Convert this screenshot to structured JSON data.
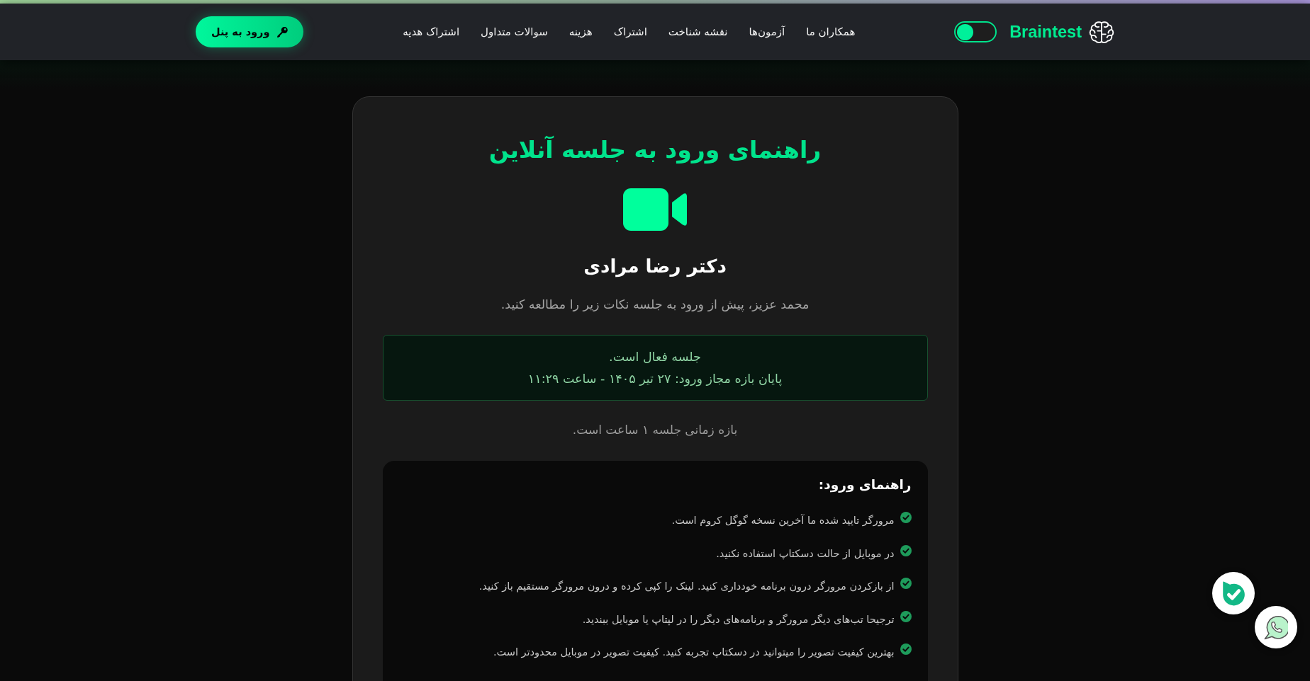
{
  "header": {
    "logo": "Braintest",
    "theme_toggle": {
      "on": false
    },
    "nav": [
      {
        "label": "همکاران ما"
      },
      {
        "label": "آزمون‌ها"
      },
      {
        "label": "نقشه شناخت"
      },
      {
        "label": "اشتراک"
      },
      {
        "label": "هزینه"
      },
      {
        "label": "سوالات متداول"
      },
      {
        "label": "اشتراک هدیه"
      }
    ],
    "login_button": "ورود به پنل"
  },
  "session_card": {
    "title": "راهنمای ورود به جلسه آنلاین",
    "host_name": "دکتر رضا مرادی",
    "intro": "محمد عزیز، پیش از ورود به جلسه نکات زیر را مطالعه کنید.",
    "status": {
      "active": true,
      "lines": [
        "جلسه فعال است.",
        "پایان بازه مجاز ورود: ۲۷ تیر ۱۴۰۵ - ساعت ۱۱:۲۹"
      ]
    },
    "duration": "بازه زمانی جلسه ۱ ساعت است.",
    "guide": {
      "title": "راهنمای ورود:",
      "items": [
        "مرورگر تایید شده ما آخرین نسخه گوگل کروم است.",
        "در موبایل از حالت دسکتاپ استفاده نکنید.",
        "از بازکردن مرورگر درون برنامه خودداری کنید. لینک را کپی کرده و درون مرورگر مستقیم باز کنید.",
        "ترجیحا تب‌های دیگر مرورگر و برنامه‌های دیگر را در لپتاپ یا موبایل ببندید.",
        "بهترین کیفیت تصویر را میتوانید در دسکتاپ تجربه کنید. کیفیت تصویر در موبایل محدودتر است."
      ]
    }
  },
  "floating_buttons": [
    {
      "kind": "check"
    },
    {
      "kind": "chat"
    }
  ]
}
